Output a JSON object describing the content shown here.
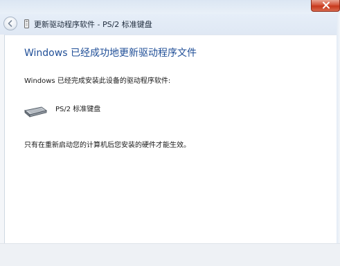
{
  "window": {
    "nav_title": "更新驱动程序软件 - PS/2 标准键盘"
  },
  "content": {
    "heading": "Windows 已经成功地更新驱动程序文件",
    "description": "Windows 已经完成安装此设备的驱动程序软件:",
    "device": {
      "name": "PS/2 标准键盘",
      "icon": "keyboard-device-icon"
    },
    "note": "只有在重新启动您的计算机后您安装的硬件才能生效。"
  },
  "icons": {
    "close": "close-icon",
    "back": "back-arrow-icon",
    "nav": "device-small-icon"
  },
  "colors": {
    "heading": "#1f4e97",
    "close_button": "#c7381c",
    "nav_bar": "#e6eef8"
  }
}
